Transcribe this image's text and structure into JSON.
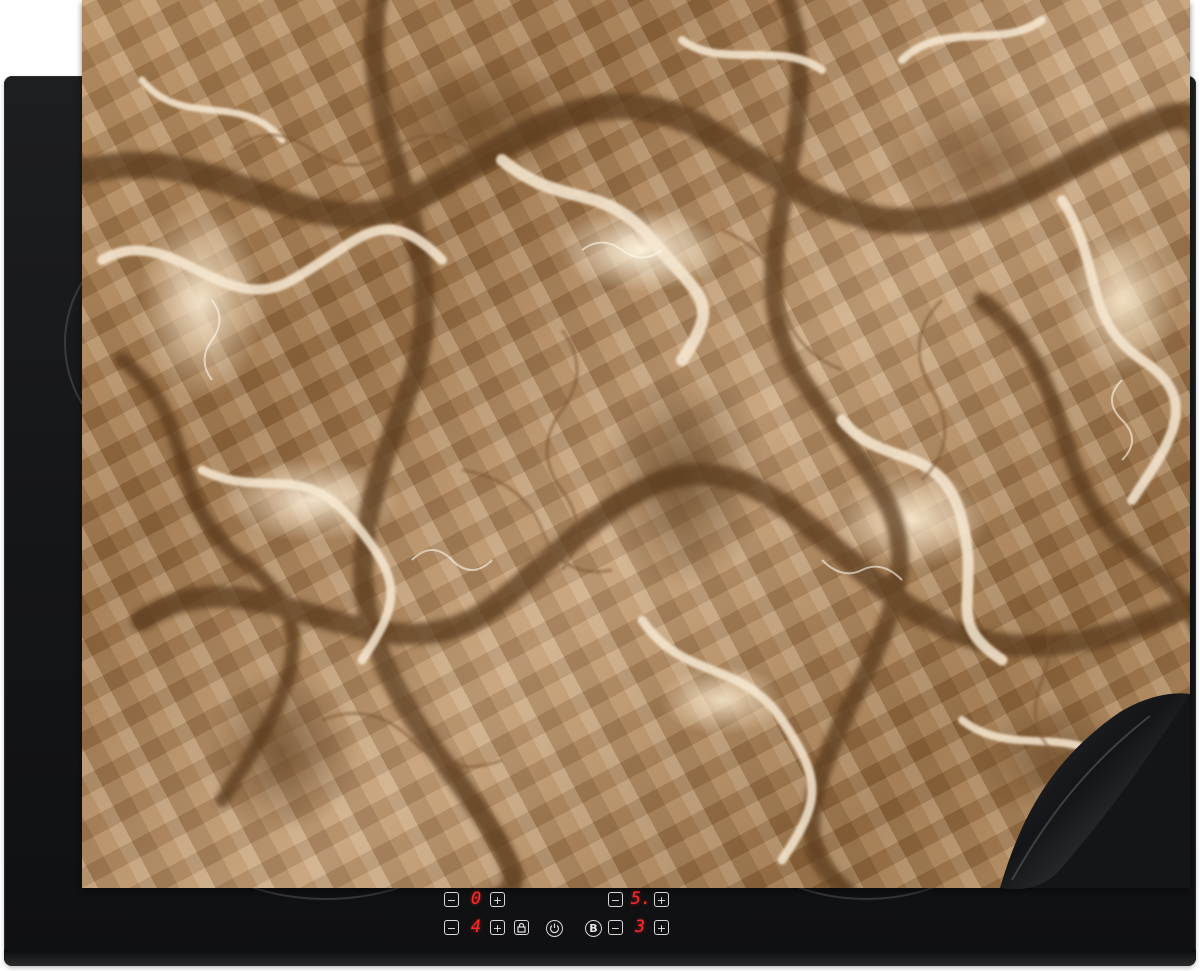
{
  "product": {
    "surface_colors": {
      "hob": "#141517",
      "mat_base": "#b58c5f",
      "mat_dark": "#5e3d1e",
      "mat_light": "#f6e8d2",
      "display_red": "#ff2a2a"
    }
  },
  "controls": {
    "left_upper_minus": "−",
    "left_upper_value": "0",
    "left_upper_plus": "+",
    "left_lower_minus": "−",
    "left_lower_value": "4",
    "left_lower_plus": "+",
    "lock_icon": "lock-icon",
    "power_icon": "power-icon",
    "boost_label": "B",
    "right_upper_minus": "−",
    "right_upper_value": "5.",
    "right_upper_plus": "+",
    "right_lower_minus": "−",
    "right_lower_value": "3",
    "right_lower_plus": "+"
  }
}
